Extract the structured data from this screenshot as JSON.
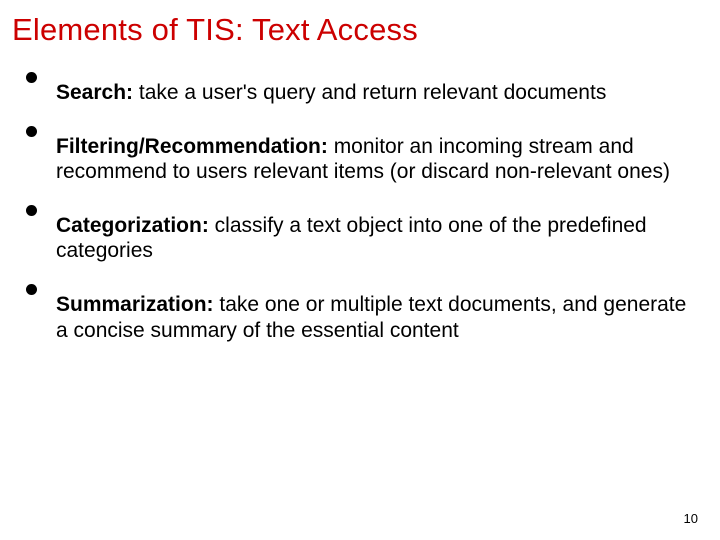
{
  "title": "Elements of TIS: Text Access",
  "bullets": [
    {
      "term": "Search:",
      "desc": " take a user's query and return relevant documents"
    },
    {
      "term": "Filtering/Recommendation:",
      "desc": " monitor an incoming stream and recommend to users relevant items (or discard non-relevant ones)"
    },
    {
      "term": "Categorization:",
      "desc": " classify a text object into one of the predefined categories"
    },
    {
      "term": "Summarization:",
      "desc": " take one or multiple text documents, and generate a concise summary of the essential content"
    }
  ],
  "page_number": "10"
}
